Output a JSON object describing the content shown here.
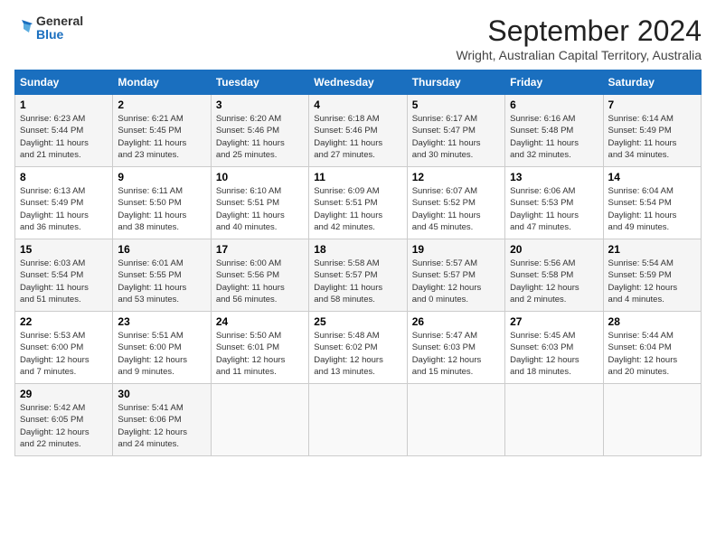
{
  "header": {
    "logo_general": "General",
    "logo_blue": "Blue",
    "month": "September 2024",
    "location": "Wright, Australian Capital Territory, Australia"
  },
  "days_of_week": [
    "Sunday",
    "Monday",
    "Tuesday",
    "Wednesday",
    "Thursday",
    "Friday",
    "Saturday"
  ],
  "weeks": [
    [
      {
        "day": "1",
        "info": "Sunrise: 6:23 AM\nSunset: 5:44 PM\nDaylight: 11 hours\nand 21 minutes."
      },
      {
        "day": "2",
        "info": "Sunrise: 6:21 AM\nSunset: 5:45 PM\nDaylight: 11 hours\nand 23 minutes."
      },
      {
        "day": "3",
        "info": "Sunrise: 6:20 AM\nSunset: 5:46 PM\nDaylight: 11 hours\nand 25 minutes."
      },
      {
        "day": "4",
        "info": "Sunrise: 6:18 AM\nSunset: 5:46 PM\nDaylight: 11 hours\nand 27 minutes."
      },
      {
        "day": "5",
        "info": "Sunrise: 6:17 AM\nSunset: 5:47 PM\nDaylight: 11 hours\nand 30 minutes."
      },
      {
        "day": "6",
        "info": "Sunrise: 6:16 AM\nSunset: 5:48 PM\nDaylight: 11 hours\nand 32 minutes."
      },
      {
        "day": "7",
        "info": "Sunrise: 6:14 AM\nSunset: 5:49 PM\nDaylight: 11 hours\nand 34 minutes."
      }
    ],
    [
      {
        "day": "8",
        "info": "Sunrise: 6:13 AM\nSunset: 5:49 PM\nDaylight: 11 hours\nand 36 minutes."
      },
      {
        "day": "9",
        "info": "Sunrise: 6:11 AM\nSunset: 5:50 PM\nDaylight: 11 hours\nand 38 minutes."
      },
      {
        "day": "10",
        "info": "Sunrise: 6:10 AM\nSunset: 5:51 PM\nDaylight: 11 hours\nand 40 minutes."
      },
      {
        "day": "11",
        "info": "Sunrise: 6:09 AM\nSunset: 5:51 PM\nDaylight: 11 hours\nand 42 minutes."
      },
      {
        "day": "12",
        "info": "Sunrise: 6:07 AM\nSunset: 5:52 PM\nDaylight: 11 hours\nand 45 minutes."
      },
      {
        "day": "13",
        "info": "Sunrise: 6:06 AM\nSunset: 5:53 PM\nDaylight: 11 hours\nand 47 minutes."
      },
      {
        "day": "14",
        "info": "Sunrise: 6:04 AM\nSunset: 5:54 PM\nDaylight: 11 hours\nand 49 minutes."
      }
    ],
    [
      {
        "day": "15",
        "info": "Sunrise: 6:03 AM\nSunset: 5:54 PM\nDaylight: 11 hours\nand 51 minutes."
      },
      {
        "day": "16",
        "info": "Sunrise: 6:01 AM\nSunset: 5:55 PM\nDaylight: 11 hours\nand 53 minutes."
      },
      {
        "day": "17",
        "info": "Sunrise: 6:00 AM\nSunset: 5:56 PM\nDaylight: 11 hours\nand 56 minutes."
      },
      {
        "day": "18",
        "info": "Sunrise: 5:58 AM\nSunset: 5:57 PM\nDaylight: 11 hours\nand 58 minutes."
      },
      {
        "day": "19",
        "info": "Sunrise: 5:57 AM\nSunset: 5:57 PM\nDaylight: 12 hours\nand 0 minutes."
      },
      {
        "day": "20",
        "info": "Sunrise: 5:56 AM\nSunset: 5:58 PM\nDaylight: 12 hours\nand 2 minutes."
      },
      {
        "day": "21",
        "info": "Sunrise: 5:54 AM\nSunset: 5:59 PM\nDaylight: 12 hours\nand 4 minutes."
      }
    ],
    [
      {
        "day": "22",
        "info": "Sunrise: 5:53 AM\nSunset: 6:00 PM\nDaylight: 12 hours\nand 7 minutes."
      },
      {
        "day": "23",
        "info": "Sunrise: 5:51 AM\nSunset: 6:00 PM\nDaylight: 12 hours\nand 9 minutes."
      },
      {
        "day": "24",
        "info": "Sunrise: 5:50 AM\nSunset: 6:01 PM\nDaylight: 12 hours\nand 11 minutes."
      },
      {
        "day": "25",
        "info": "Sunrise: 5:48 AM\nSunset: 6:02 PM\nDaylight: 12 hours\nand 13 minutes."
      },
      {
        "day": "26",
        "info": "Sunrise: 5:47 AM\nSunset: 6:03 PM\nDaylight: 12 hours\nand 15 minutes."
      },
      {
        "day": "27",
        "info": "Sunrise: 5:45 AM\nSunset: 6:03 PM\nDaylight: 12 hours\nand 18 minutes."
      },
      {
        "day": "28",
        "info": "Sunrise: 5:44 AM\nSunset: 6:04 PM\nDaylight: 12 hours\nand 20 minutes."
      }
    ],
    [
      {
        "day": "29",
        "info": "Sunrise: 5:42 AM\nSunset: 6:05 PM\nDaylight: 12 hours\nand 22 minutes."
      },
      {
        "day": "30",
        "info": "Sunrise: 5:41 AM\nSunset: 6:06 PM\nDaylight: 12 hours\nand 24 minutes."
      },
      {
        "day": "",
        "info": ""
      },
      {
        "day": "",
        "info": ""
      },
      {
        "day": "",
        "info": ""
      },
      {
        "day": "",
        "info": ""
      },
      {
        "day": "",
        "info": ""
      }
    ]
  ]
}
